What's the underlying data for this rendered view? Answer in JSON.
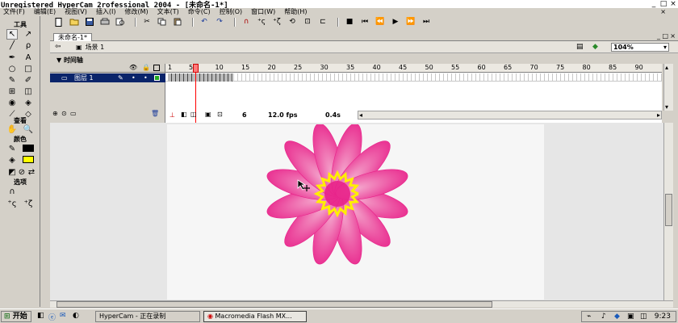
{
  "window": {
    "title": "Unregistered HyperCam 2rofessional 2004 - [未命名-1*]",
    "controls": [
      "_",
      "□",
      "×"
    ]
  },
  "menu": {
    "items": [
      "文件(F)",
      "编辑(E)",
      "视图(V)",
      "插入(I)",
      "修改(M)",
      "文本(T)",
      "命令(C)",
      "控制(O)",
      "窗口(W)",
      "帮助(H)"
    ],
    "close": "×"
  },
  "tools": {
    "heading": "工具",
    "view_heading": "查看",
    "colors_heading": "颜色",
    "options_heading": "选项",
    "stroke_color": "#000000",
    "fill_color": "#ffff00"
  },
  "document": {
    "tab_label": "未命名-1*",
    "scene_label": "场景 1",
    "zoom": "104%"
  },
  "timeline": {
    "heading": "时间轴",
    "layer_name": "图层 1",
    "ruler_numbers": [
      "1",
      "5",
      "10",
      "15",
      "20",
      "25",
      "30",
      "35",
      "40",
      "45",
      "50",
      "55",
      "60",
      "65",
      "70",
      "75",
      "80",
      "85",
      "90"
    ],
    "current_frame": "6",
    "frame_rate": "12.0 fps",
    "elapsed": "0.4s",
    "filled_frames": 16,
    "playhead_frame": 6
  },
  "colors": {
    "flower_outer": "#e8228a",
    "flower_inner": "#f4a6cc",
    "center_yellow": "#ffee00",
    "selected_layer": "#0a246a",
    "playhead": "#ff0000"
  },
  "taskbar": {
    "start": "开始",
    "tasks": [
      "HyperCam - 正在录制",
      "Macromedia Flash MX..."
    ],
    "clock": "9:23"
  }
}
